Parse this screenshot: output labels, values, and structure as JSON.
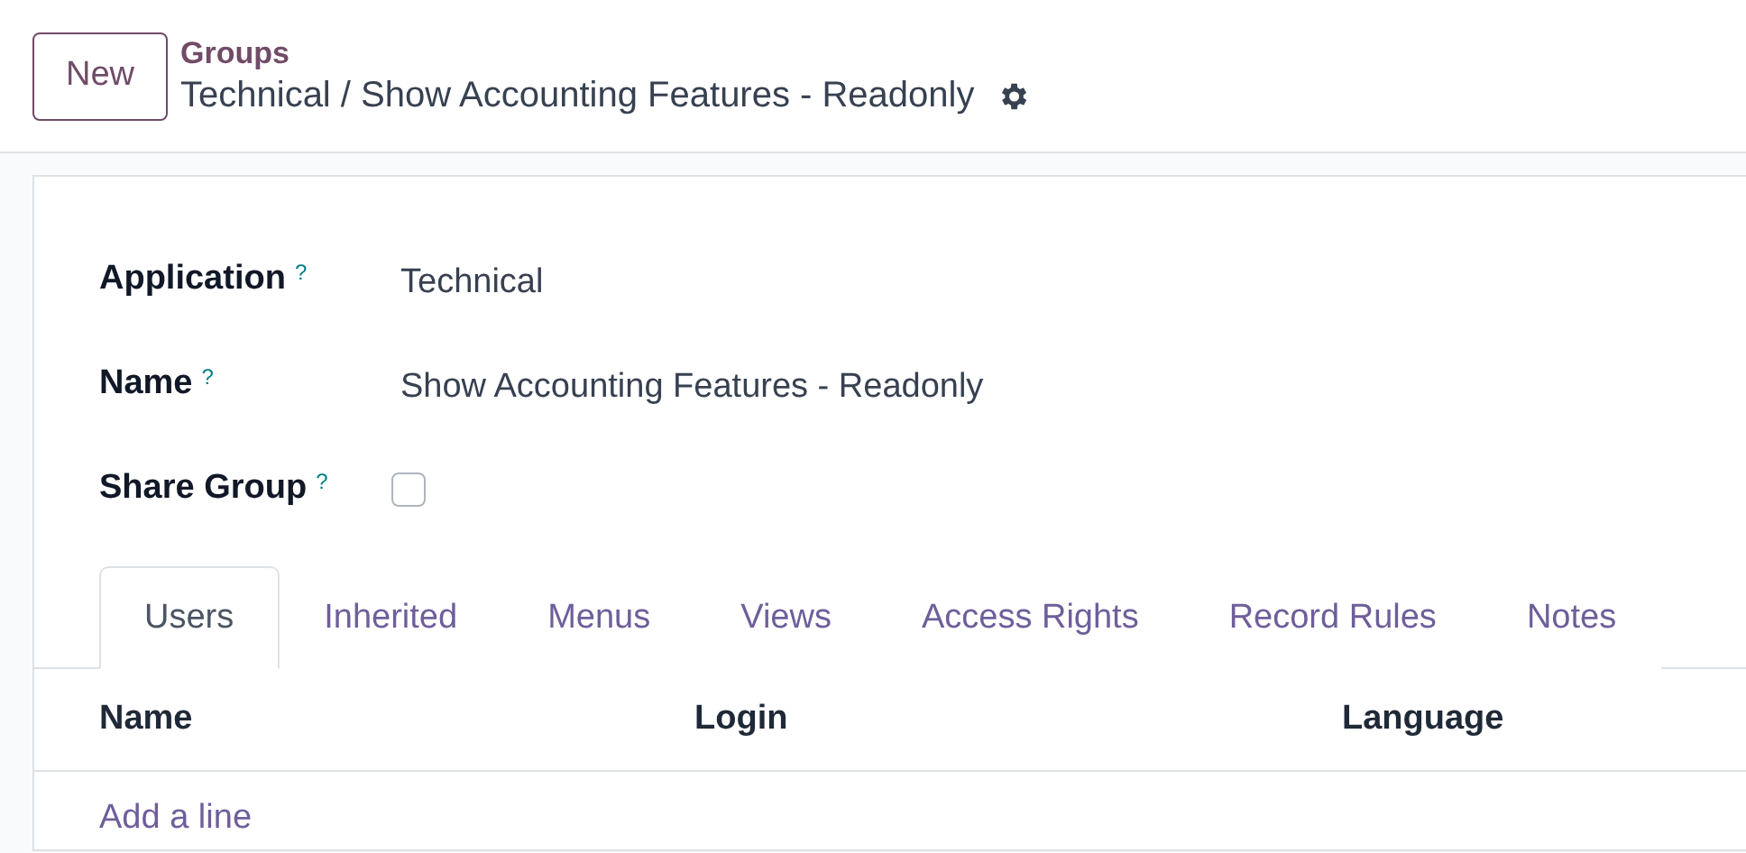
{
  "control_panel": {
    "new_button": "New",
    "breadcrumb": "Groups",
    "record_title": "Technical / Show Accounting Features - Readonly"
  },
  "fields": [
    {
      "kind": "text",
      "label": "Application",
      "help": "?",
      "value": "Technical"
    },
    {
      "kind": "text",
      "label": "Name",
      "help": "?",
      "value": "Show Accounting Features - Readonly"
    },
    {
      "kind": "checkbox",
      "label": "Share Group",
      "help": "?",
      "checked": false
    }
  ],
  "tabs": [
    {
      "label": "Users",
      "selected": true
    },
    {
      "label": "Inherited",
      "selected": false
    },
    {
      "label": "Menus",
      "selected": false
    },
    {
      "label": "Views",
      "selected": false
    },
    {
      "label": "Access Rights",
      "selected": false
    },
    {
      "label": "Record Rules",
      "selected": false
    },
    {
      "label": "Notes",
      "selected": false
    }
  ],
  "table": {
    "columns": [
      "Name",
      "Login",
      "Language"
    ],
    "add_line": "Add a line"
  }
}
